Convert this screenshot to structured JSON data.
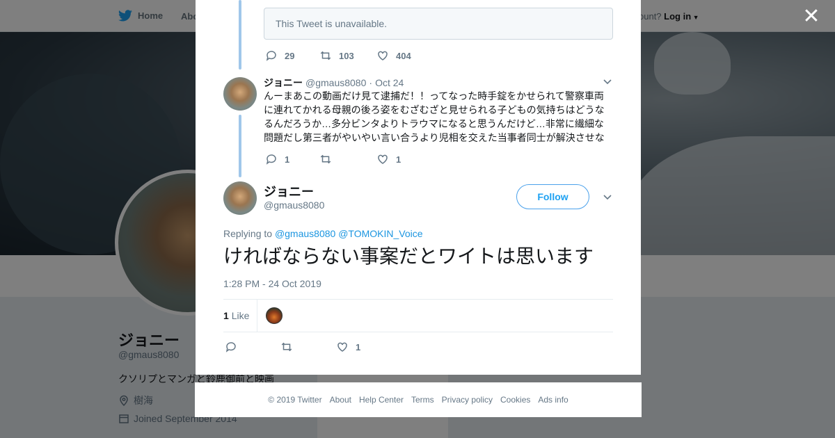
{
  "nav": {
    "home": "Home",
    "about": "Abo",
    "account_prompt": "ccount?",
    "login": "Log in"
  },
  "profile": {
    "name": "ジョニー",
    "handle": "@gmaus8080",
    "bio": "クソリプとマンガと鈴鹿御前と映画",
    "location": "樹海",
    "joined": "Joined September 2014"
  },
  "thread": {
    "unavailable_text": "This Tweet is unavailable.",
    "unavailable_actions": {
      "replies": "29",
      "retweets": "103",
      "likes": "404"
    },
    "reply": {
      "name": "ジョニー",
      "handle": "@gmaus8080",
      "separator": "·",
      "date": "Oct 24",
      "text": "んーまあこの動画だけ見て逮捕だ！！ってなった時手錠をかせられて警察車両\nに連れてかれる母親の後ろ姿をむざむざと見せられる子どもの気持ちはどうな\nるんだろうか…多分ビンタよりトラウマになると思うんだけど…非常に繊細な\n問題だし第三者がやいやい言い合うより児相を交えた当事者同士が解決させな",
      "replies": "1",
      "retweets": "",
      "likes": "1"
    }
  },
  "main_tweet": {
    "name": "ジョニー",
    "handle": "@gmaus8080",
    "follow_label": "Follow",
    "replying_prefix": "Replying to",
    "replying_to_1": "@gmaus8080",
    "replying_to_2": "@TOMOKIN_Voice",
    "text": "ければならない事案だとワイトは思います",
    "timestamp": "1:28 PM - 24 Oct 2019",
    "like_count": "1",
    "like_label": "Like",
    "actions": {
      "replies": "",
      "retweets": "",
      "likes": "1"
    }
  },
  "footer": [
    "© 2019 Twitter",
    "About",
    "Help Center",
    "Terms",
    "Privacy policy",
    "Cookies",
    "Ads info"
  ],
  "colors": {
    "accent": "#1da1f2",
    "thread_line": "#a0c7ea",
    "muted": "#657786"
  }
}
